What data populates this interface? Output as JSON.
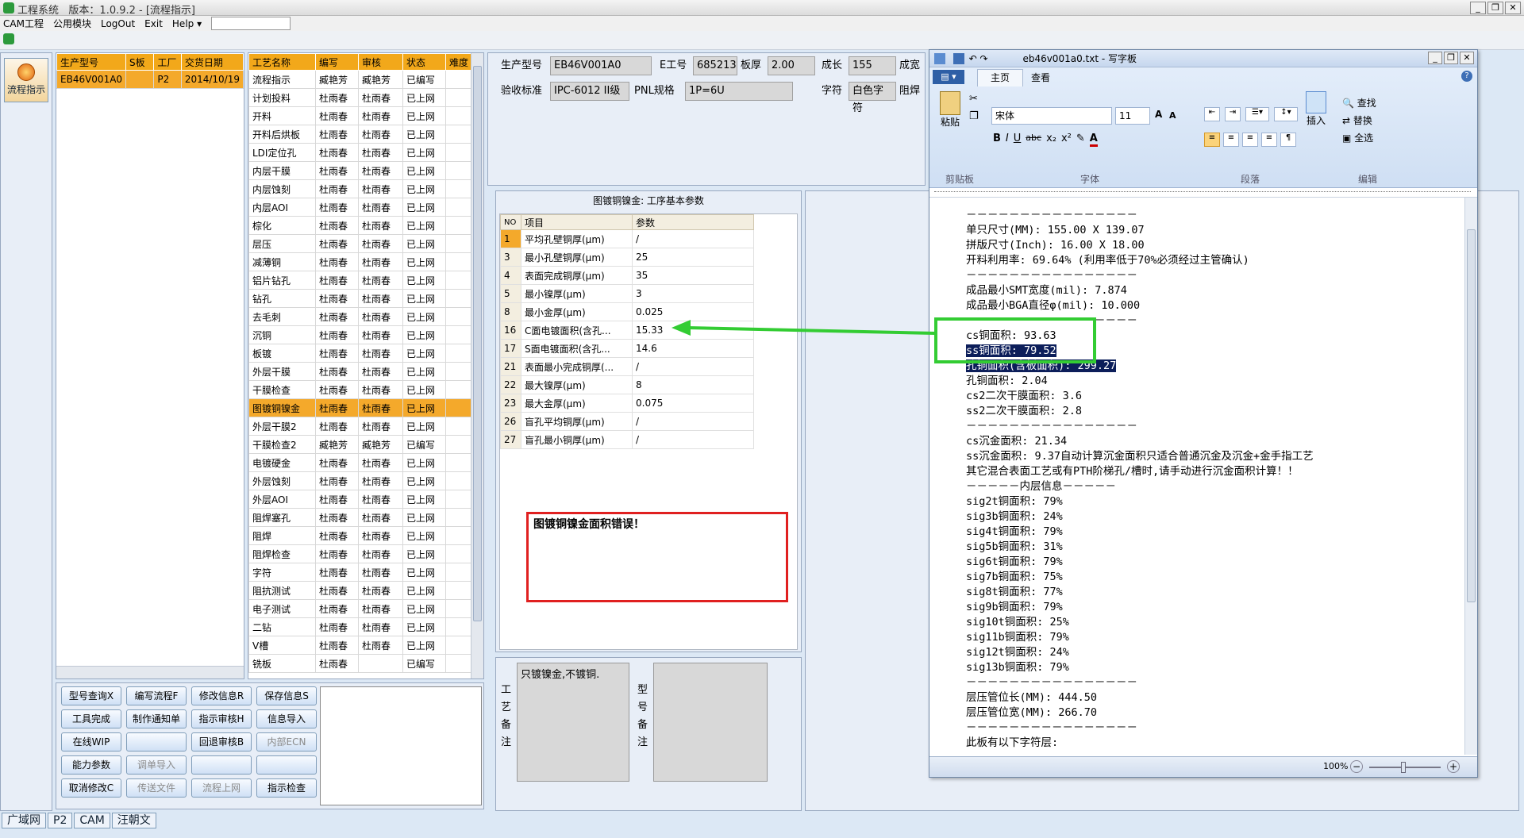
{
  "app": {
    "title": "工程系统",
    "version": "版本：1.0.9.2 - [流程指示]"
  },
  "menu": [
    "CAM工程",
    "公用模块",
    "LogOut",
    "Exit",
    "Help"
  ],
  "left_nav": {
    "label": "流程指示"
  },
  "model_table": {
    "headers": [
      "生产型号",
      "S板",
      "工厂",
      "交货日期"
    ],
    "rows": [
      [
        "EB46V001A0",
        "",
        "P2",
        "2014/10/19"
      ]
    ]
  },
  "process_table": {
    "headers": [
      "工艺名称",
      "编写",
      "审核",
      "状态",
      "难度"
    ],
    "rows": [
      [
        "流程指示",
        "臧艳芳",
        "臧艳芳",
        "已编写",
        ""
      ],
      [
        "计划投料",
        "杜雨春",
        "杜雨春",
        "已上网",
        ""
      ],
      [
        "开料",
        "杜雨春",
        "杜雨春",
        "已上网",
        ""
      ],
      [
        "开料后烘板",
        "杜雨春",
        "杜雨春",
        "已上网",
        ""
      ],
      [
        "LDI定位孔",
        "杜雨春",
        "杜雨春",
        "已上网",
        ""
      ],
      [
        "内层干膜",
        "杜雨春",
        "杜雨春",
        "已上网",
        ""
      ],
      [
        "内层蚀刻",
        "杜雨春",
        "杜雨春",
        "已上网",
        ""
      ],
      [
        "内层AOI",
        "杜雨春",
        "杜雨春",
        "已上网",
        ""
      ],
      [
        "棕化",
        "杜雨春",
        "杜雨春",
        "已上网",
        ""
      ],
      [
        "层压",
        "杜雨春",
        "杜雨春",
        "已上网",
        ""
      ],
      [
        "减薄铜",
        "杜雨春",
        "杜雨春",
        "已上网",
        ""
      ],
      [
        "铝片钻孔",
        "杜雨春",
        "杜雨春",
        "已上网",
        ""
      ],
      [
        "钻孔",
        "杜雨春",
        "杜雨春",
        "已上网",
        ""
      ],
      [
        "去毛刺",
        "杜雨春",
        "杜雨春",
        "已上网",
        ""
      ],
      [
        "沉铜",
        "杜雨春",
        "杜雨春",
        "已上网",
        ""
      ],
      [
        "板镀",
        "杜雨春",
        "杜雨春",
        "已上网",
        ""
      ],
      [
        "外层干膜",
        "杜雨春",
        "杜雨春",
        "已上网",
        ""
      ],
      [
        "干膜检查",
        "杜雨春",
        "杜雨春",
        "已上网",
        ""
      ],
      [
        "图镀铜镍金",
        "杜雨春",
        "杜雨春",
        "已上网",
        ""
      ],
      [
        "外层干膜2",
        "杜雨春",
        "杜雨春",
        "已上网",
        ""
      ],
      [
        "干膜检查2",
        "臧艳芳",
        "臧艳芳",
        "已编写",
        ""
      ],
      [
        "电镀硬金",
        "杜雨春",
        "杜雨春",
        "已上网",
        ""
      ],
      [
        "外层蚀刻",
        "杜雨春",
        "杜雨春",
        "已上网",
        ""
      ],
      [
        "外层AOI",
        "杜雨春",
        "杜雨春",
        "已上网",
        ""
      ],
      [
        "阻焊塞孔",
        "杜雨春",
        "杜雨春",
        "已上网",
        ""
      ],
      [
        "阻焊",
        "杜雨春",
        "杜雨春",
        "已上网",
        ""
      ],
      [
        "阻焊检查",
        "杜雨春",
        "杜雨春",
        "已上网",
        ""
      ],
      [
        "字符",
        "杜雨春",
        "杜雨春",
        "已上网",
        ""
      ],
      [
        "阻抗测试",
        "杜雨春",
        "杜雨春",
        "已上网",
        ""
      ],
      [
        "电子测试",
        "杜雨春",
        "杜雨春",
        "已上网",
        ""
      ],
      [
        "二钻",
        "杜雨春",
        "杜雨春",
        "已上网",
        ""
      ],
      [
        "V槽",
        "杜雨春",
        "杜雨春",
        "已上网",
        ""
      ],
      [
        "铣板",
        "杜雨春",
        "",
        "已编写",
        ""
      ]
    ],
    "selected_index": 18
  },
  "buttons": [
    [
      "型号查询X",
      "编写流程F",
      "修改信息R",
      "保存信息S"
    ],
    [
      "工具完成",
      "制作通知单",
      "指示审核H",
      "信息导入"
    ],
    [
      "在线WIP",
      "",
      "回退审核B",
      "内部ECN"
    ],
    [
      "能力参数",
      "调单导入",
      "",
      ""
    ],
    [
      "取消修改C",
      "传送文件",
      "流程上网",
      "指示检查"
    ]
  ],
  "disabled_buttons": [
    "内部ECN",
    "调单导入",
    "传送文件",
    "流程上网"
  ],
  "info": {
    "prod_label": "生产型号",
    "prod_value": "EB46V001A0",
    "eng_label": "E工号",
    "eng_value": "685213",
    "thick_label": "板厚",
    "thick_value": "2.00",
    "len_label": "成长",
    "len_value": "155",
    "wid_label": "成宽",
    "std_label": "验收标准",
    "std_value": "IPC-6012 II级",
    "pnl_label": "PNL规格",
    "pnl_value": "1P=6U",
    "char_label": "字符",
    "char_value": "白色字符",
    "mask_label": "阻焊"
  },
  "param_panel": {
    "title": "图镀铜镍金: 工序基本参数",
    "headers": [
      "NO",
      "项目",
      "参数"
    ],
    "rows": [
      [
        "1",
        "平均孔壁铜厚(μm)",
        "/"
      ],
      [
        "3",
        "最小孔壁铜厚(μm)",
        "25"
      ],
      [
        "4",
        "表面完成铜厚(μm)",
        "35"
      ],
      [
        "5",
        "最小镍厚(μm)",
        "3"
      ],
      [
        "8",
        "最小金厚(μm)",
        "0.025"
      ],
      [
        "16",
        "C面电镀面积(含孔...",
        "15.33"
      ],
      [
        "17",
        "S面电镀面积(含孔...",
        "14.6"
      ],
      [
        "21",
        "表面最小完成铜厚(...",
        "/"
      ],
      [
        "22",
        "最大镍厚(μm)",
        "8"
      ],
      [
        "23",
        "最大金厚(μm)",
        "0.075"
      ],
      [
        "26",
        "盲孔平均铜厚(μm)",
        "/"
      ],
      [
        "27",
        "盲孔最小铜厚(μm)",
        "/"
      ]
    ]
  },
  "error_box": "图镀铜镍金面积错误！",
  "notes": {
    "process_label": [
      "工",
      "艺",
      "备",
      "注"
    ],
    "process_text": "只镀镍金,不镀铜.",
    "model_label": [
      "型",
      "号",
      "备",
      "注"
    ]
  },
  "wordpad": {
    "title": "eb46v001a0.txt - 写字板",
    "tabs": [
      "主页",
      "查看"
    ],
    "font": "宋体",
    "size": "11",
    "groups": [
      "剪贴板",
      "字体",
      "段落",
      "编辑"
    ],
    "paste": "粘贴",
    "insert": "插入",
    "edit_items": [
      "查找",
      "替换",
      "全选"
    ],
    "zoom": "100%",
    "lines": [
      "－－－－－－－－－－－－－－－－",
      "单只尺寸(MM): 155.00 X 139.07",
      "拼版尺寸(Inch): 16.00 X 18.00",
      "开料利用率: 69.64% (利用率低于70%必须经过主管确认)",
      "－－－－－－－－－－－－－－－－",
      "成品最小SMT宽度(mil): 7.874",
      "成品最小BGA直径φ(mil): 10.000",
      "－－－－－－－－－－－－－－－－",
      "cs铜面积: 93.63",
      "ss铜面积: 79.52",
      "孔铜面积(含板面积): 299.27",
      "孔铜面积: 2.04",
      "cs2二次干膜面积: 3.6",
      "ss2二次干膜面积: 2.8",
      "－－－－－－－－－－－－－－－－",
      "cs沉金面积: 21.34",
      "ss沉金面积: 9.37自动计算沉金面积只适合普通沉金及沉金+金手指工艺",
      "其它混合表面工艺或有PTH阶梯孔/槽时,请手动进行沉金面积计算！！",
      "－－－－－内层信息－－－－－",
      "sig2t铜面积: 79%",
      "sig3b铜面积: 24%",
      "sig4t铜面积: 79%",
      "sig5b铜面积: 31%",
      "sig6t铜面积: 79%",
      "sig7b铜面积: 75%",
      "sig8t铜面积: 77%",
      "sig9b铜面积: 79%",
      "sig10t铜面积: 25%",
      "sig11b铜面积: 79%",
      "sig12t铜面积: 24%",
      "sig13b铜面积: 79%",
      "－－－－－－－－－－－－－－－－",
      "层压管位长(MM): 444.50",
      "层压管位宽(MM): 266.70",
      "－－－－－－－－－－－－－－－－",
      "此板有以下字符层:"
    ],
    "highlight": [
      9,
      10
    ]
  },
  "taskbar": [
    "广域网",
    "P2",
    "CAM",
    "汪朝文"
  ],
  "colors": {
    "accent": "#f4a92b",
    "highlight": "#0c1e5a",
    "arrow": "#33cc33",
    "error": "#e02020"
  }
}
